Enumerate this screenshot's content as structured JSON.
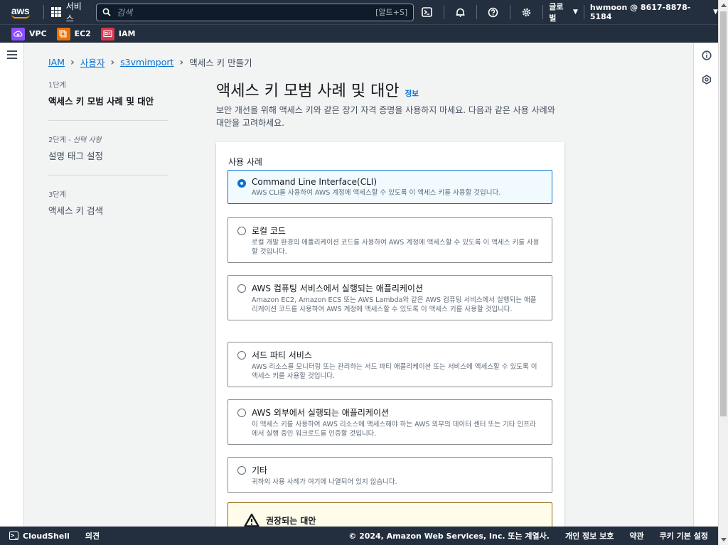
{
  "topnav": {
    "logo_text": "aws",
    "services_label": "서비스",
    "search_placeholder": "검색",
    "search_shortcut": "[알트+S]",
    "region_label": "글로벌",
    "account_label": "hwmoon @ 8617-8878-5184"
  },
  "favorites": [
    {
      "label": "VPC",
      "color": "#8c4fff"
    },
    {
      "label": "EC2",
      "color": "#ed7100"
    },
    {
      "label": "IAM",
      "color": "#dd344c"
    }
  ],
  "breadcrumb": {
    "items": [
      "IAM",
      "사용자",
      "s3vmimport"
    ],
    "current": "액세스 키 만들기"
  },
  "steps": [
    {
      "number": "1단계",
      "optional": "",
      "title": "액세스 키 모범 사례 및 대안"
    },
    {
      "number": "2단계 - ",
      "optional": "선택 사항",
      "title": "설명 태그 설정"
    },
    {
      "number": "3단계",
      "optional": "",
      "title": "액세스 키 검색"
    }
  ],
  "main": {
    "title": "액세스 키 모범 사례 및 대안",
    "info_link": "정보",
    "description": "보안 개선을 위해 액세스 키와 같은 장기 자격 증명을 사용하지 마세요. 다음과 같은 사용 사례와 대안을 고려하세요."
  },
  "use_cases": {
    "label": "사용 사례",
    "selected_index": 0,
    "options": [
      {
        "title": "Command Line Interface(CLI)",
        "desc": "AWS CLI를 사용하여 AWS 계정에 액세스할 수 있도록 이 액세스 키를 사용할 것입니다."
      },
      {
        "title": "로컬 코드",
        "desc": "로컬 개발 환경의 애플리케이션 코드를 사용하여 AWS 계정에 액세스할 수 있도록 이 액세스 키를 사용할 것입니다."
      },
      {
        "title": "AWS 컴퓨팅 서비스에서 실행되는 애플리케이션",
        "desc": "Amazon EC2, Amazon ECS 또는 AWS Lambda와 같은 AWS 컴퓨팅 서비스에서 실행되는 애플리케이션 코드를 사용하여 AWS 계정에 액세스할 수 있도록 이 액세스 키를 사용할 것입니다."
      },
      {
        "title": "서드 파티 서비스",
        "desc": "AWS 리소스를 모니터링 또는 관리하는 서드 파티 애플리케이션 또는 서비스에 액세스할 수 있도록 이 액세스 키를 사용할 것입니다."
      },
      {
        "title": "AWS 외부에서 실행되는 애플리케이션",
        "desc": "이 액세스 키를 사용하여 AWS 리소스에 액세스해야 하는 AWS 외부의 데이터 센터 또는 기타 인프라에서 실행 중인 워크로드를 인증할 것입니다."
      },
      {
        "title": "기타",
        "desc": "귀하의 사용 사례가 여기에 나열되어 있지 않습니다."
      }
    ]
  },
  "alert": {
    "title": "권장되는 대안"
  },
  "footer": {
    "cloudshell": "CloudShell",
    "feedback": "의견",
    "copyright": "© 2024, Amazon Web Services, Inc. 또는 계열사.",
    "privacy": "개인 정보 보호",
    "terms": "약관",
    "cookies": "쿠키 기본 설정"
  },
  "colors": {
    "nav_bg": "#232f3e",
    "link": "#0972d3",
    "selected_bg": "#f1faff",
    "warning_border": "#8d6605",
    "warning_bg": "#fffce9"
  }
}
